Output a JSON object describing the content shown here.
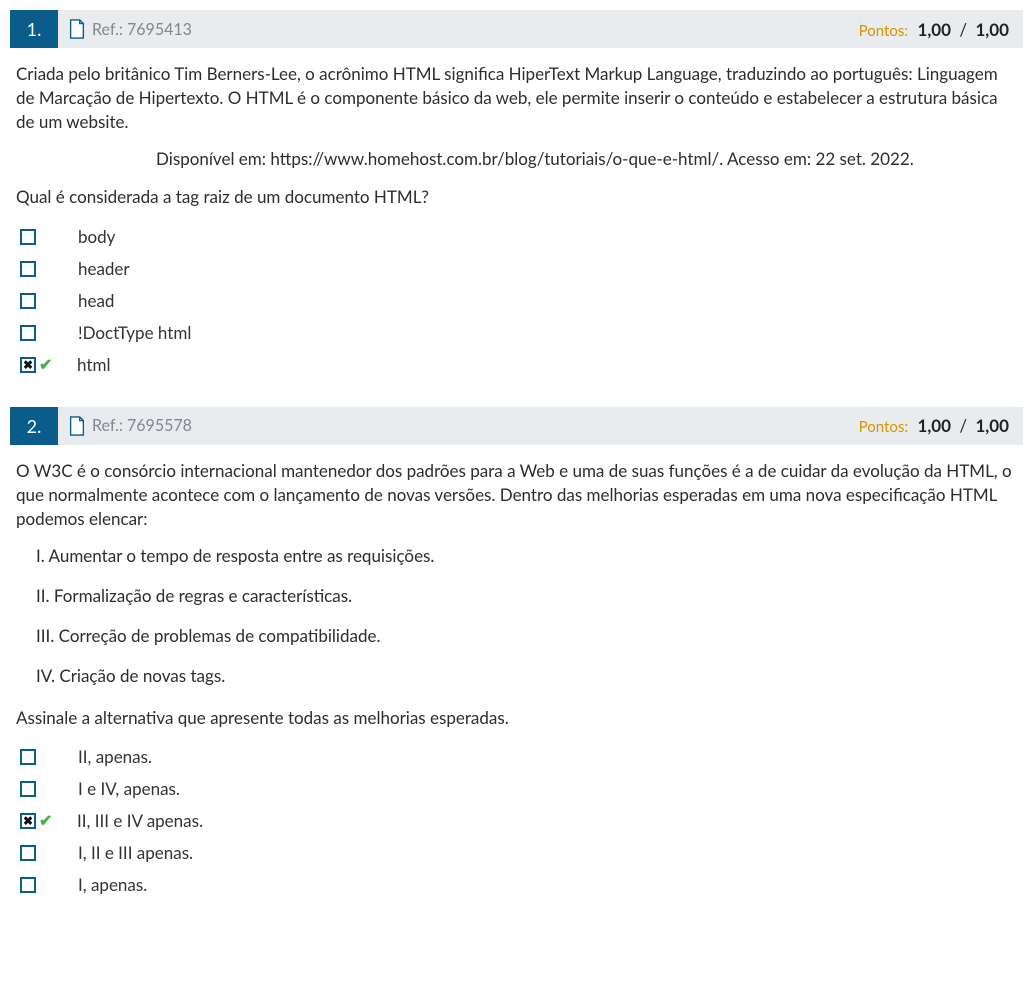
{
  "points_label": "Pontos:",
  "questions": [
    {
      "number": "1.",
      "ref": "Ref.: 7695413",
      "score_earned": "1,00",
      "score_total": "1,00",
      "body_p1": "Criada pelo britânico Tim Berners-Lee, o acrônimo HTML significa HiperText Markup Language, traduzindo ao português: Linguagem de Marcação de Hipertexto.  O HTML é o componente básico da web, ele permite inserir o conteúdo e estabelecer a estrutura básica de um website.",
      "source": "Disponível em: https://www.homehost.com.br/blog/tutoriais/o-que-e-html/. Acesso em: 22 set. 2022.",
      "prompt": "Qual é considerada a tag raiz de um documento HTML?",
      "options": [
        {
          "label": "body",
          "checked": false,
          "correct": false
        },
        {
          "label": "header",
          "checked": false,
          "correct": false
        },
        {
          "label": "head",
          "checked": false,
          "correct": false
        },
        {
          "label": "!DoctType html",
          "checked": false,
          "correct": false
        },
        {
          "label": "html",
          "checked": true,
          "correct": true
        }
      ]
    },
    {
      "number": "2.",
      "ref": "Ref.: 7695578",
      "score_earned": "1,00",
      "score_total": "1,00",
      "body_p1": "O W3C é o consórcio internacional mantenedor dos padrões para a Web e uma de suas funções é a de cuidar da evolução da HTML, o que normalmente acontece com o lançamento de novas versões. Dentro das melhorias esperadas em uma nova especificação HTML podemos elencar:",
      "statements": [
        "I. Aumentar o tempo de resposta entre as requisições.",
        "II. Formalização de regras e características.",
        "III. Correção de problemas de compatibilidade.",
        "IV. Criação de novas tags."
      ],
      "prompt": "Assinale a alternativa que apresente todas as melhorias esperadas.",
      "options": [
        {
          "label": "II, apenas.",
          "checked": false,
          "correct": false
        },
        {
          "label": "I e IV, apenas.",
          "checked": false,
          "correct": false
        },
        {
          "label": "II, III e IV apenas.",
          "checked": true,
          "correct": true
        },
        {
          "label": "I, II e III apenas.",
          "checked": false,
          "correct": false
        },
        {
          "label": "I, apenas.",
          "checked": false,
          "correct": false
        }
      ]
    }
  ]
}
